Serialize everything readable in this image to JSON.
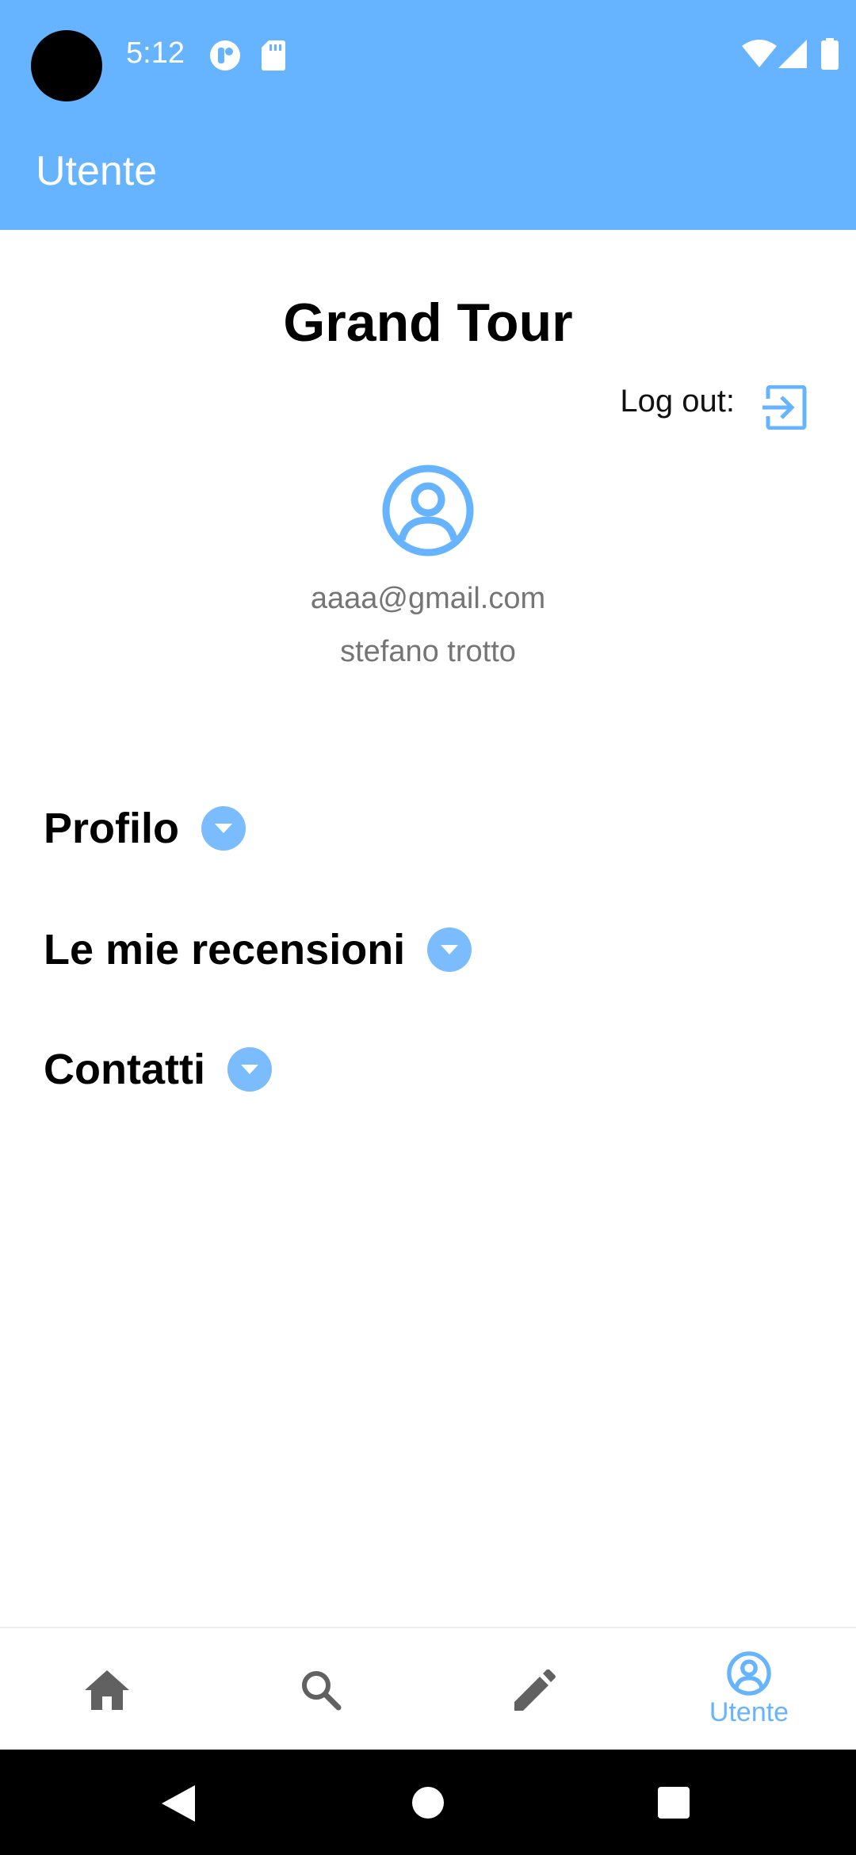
{
  "status_bar": {
    "time": "5:12"
  },
  "app_bar": {
    "title": "Utente"
  },
  "main": {
    "brand_title": "Grand Tour",
    "logout_label": "Log out:",
    "email": "aaaa@gmail.com",
    "name": "stefano trotto",
    "sections": [
      {
        "label": "Profilo"
      },
      {
        "label": "Le mie recensioni"
      },
      {
        "label": "Contatti"
      }
    ]
  },
  "bottom_nav": {
    "items": [
      {
        "icon": "home-icon",
        "label": ""
      },
      {
        "icon": "search-icon",
        "label": ""
      },
      {
        "icon": "pencil-icon",
        "label": ""
      },
      {
        "icon": "account-circle-icon",
        "label": "Utente",
        "selected": true
      }
    ]
  },
  "colors": {
    "primary": "#66b3ff",
    "dropdown": "#7bbcff",
    "inactive_icon": "#616161",
    "secondary_text": "#757575"
  }
}
